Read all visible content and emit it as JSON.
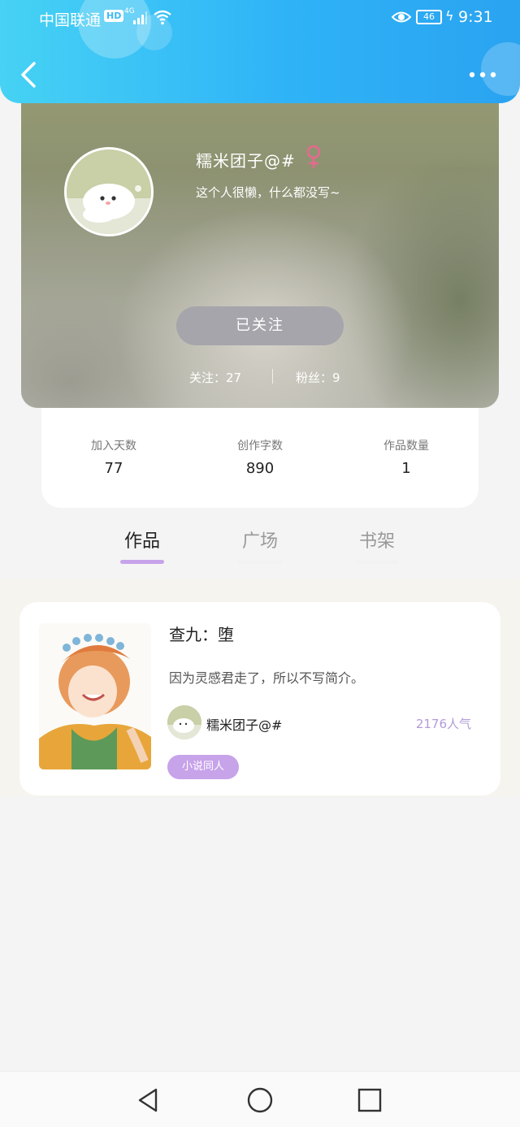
{
  "status_bar": {
    "carrier": "中国联通",
    "hd": "HD",
    "network": "4G",
    "battery": "46",
    "time": "9:31"
  },
  "profile": {
    "nickname": "糯米团子@#",
    "bio": "这个人很懒，什么都没写~",
    "follow_button": "已关注",
    "following_label": "关注：27",
    "fans_label": "粉丝：9",
    "gender_color": "#e56a8d"
  },
  "stats": [
    {
      "label": "加入天数",
      "value": "77"
    },
    {
      "label": "创作字数",
      "value": "890"
    },
    {
      "label": "作品数量",
      "value": "1"
    }
  ],
  "tabs": [
    {
      "label": "作品",
      "active": true
    },
    {
      "label": "广场",
      "active": false
    },
    {
      "label": "书架",
      "active": false
    }
  ],
  "works": [
    {
      "title": "查九：堕",
      "description": "因为灵感君走了，所以不写简介。",
      "author": "糯米团子@#",
      "popularity": "2176人气",
      "tag": "小说同人"
    }
  ],
  "colors": {
    "header_start": "#46d2f4",
    "header_end": "#2aa3f0",
    "accent_purple": "#c7a3ea",
    "popularity_purple": "#b49ad9"
  },
  "icons": {
    "back": "chevron-left-icon",
    "more": "more-dots-icon",
    "gender": "female-icon",
    "nav_back": "triangle-back-icon",
    "nav_home": "circle-home-icon",
    "nav_recent": "square-recent-icon"
  }
}
